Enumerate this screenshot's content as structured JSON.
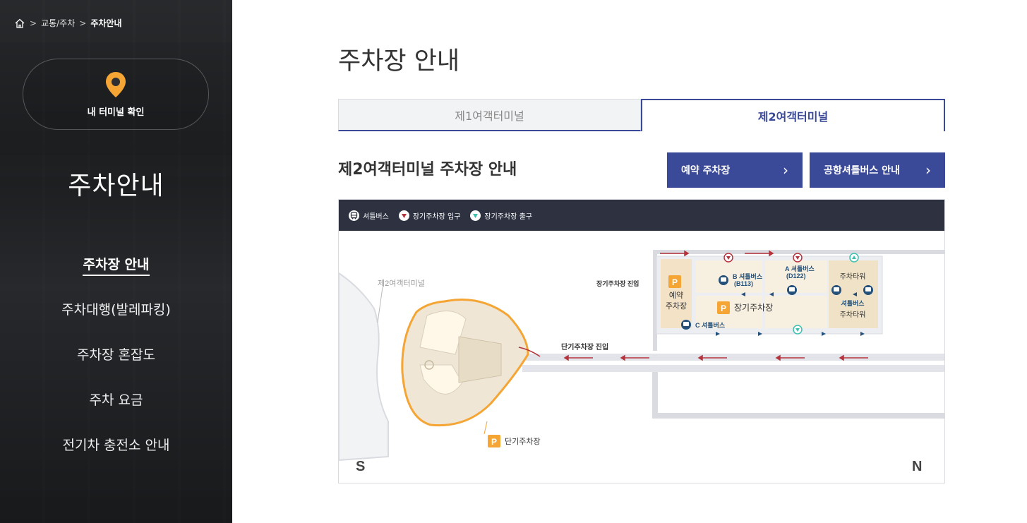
{
  "breadcrumb": {
    "level1": "교통/주차",
    "current": "주차안내"
  },
  "sidebar": {
    "terminal_check_label": "내 터미널 확인",
    "title": "주차안내",
    "menu": [
      {
        "label": "주차장 안내",
        "active": true
      },
      {
        "label": "주차대행(발레파킹)",
        "active": false
      },
      {
        "label": "주차장 혼잡도",
        "active": false
      },
      {
        "label": "주차 요금",
        "active": false
      },
      {
        "label": "전기차 충전소 안내",
        "active": false
      }
    ]
  },
  "main": {
    "page_title": "주차장 안내",
    "tabs": [
      {
        "label": "제1여객터미널",
        "active": false
      },
      {
        "label": "제2여객터미널",
        "active": true
      }
    ],
    "section_title": "제2여객터미널 주차장 안내",
    "buttons": {
      "reserve": "예약 주차장",
      "shuttle": "공항셔틀버스 안내"
    }
  },
  "map": {
    "legend": {
      "shuttle": "셔틀버스",
      "entrance": "장기주차장 입구",
      "exit": "장기주차장 출구"
    },
    "labels": {
      "terminal": "제2여객터미널",
      "long_term_entry": "장기주차장 진입",
      "short_term_entry": "단기주차장 진입",
      "short_term_lot": "단기주차장",
      "long_term_lot": "장기주차장",
      "reserved_line1": "예약",
      "reserved_line2": "주차장",
      "tower1": "주차타워",
      "tower2": "주차타워",
      "shuttle_b_line1": "B 셔틀버스",
      "shuttle_b_line2": "(B113)",
      "shuttle_a_line1": "A 셔틀버스",
      "shuttle_a_line2": "(D122)",
      "shuttle_c": "C 셔틀버스",
      "shuttle_tower": "셔틀버스",
      "parking_symbol": "P",
      "south": "S",
      "north": "N"
    }
  },
  "colors": {
    "accent": "#3b4a98",
    "pin": "#f4a534",
    "legend_bg": "#2d3140",
    "entrance": "#b5333c",
    "exit": "#3cc0b0"
  }
}
